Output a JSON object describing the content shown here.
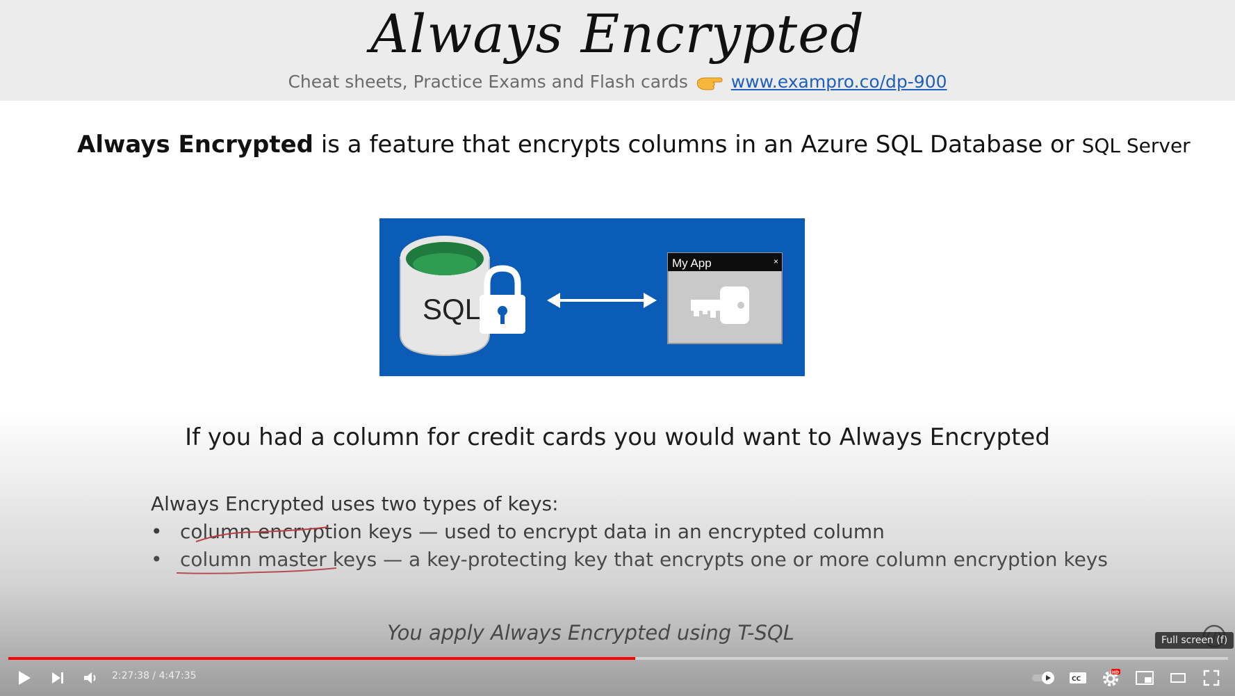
{
  "slide": {
    "title": "Always Encrypted",
    "subtitle_text": "Cheat sheets, Practice Exams and Flash cards",
    "subtitle_link": "www.exampro.co/dp-900",
    "intro_bold": "Always Encrypted",
    "intro_rest": " is a feature that encrypts columns in an Azure SQL Database or ",
    "intro_small": "SQL Server",
    "diagram": {
      "sql_label": "SQL",
      "app_title": "My App",
      "app_close": "×",
      "bg_color": "#0b5cb7"
    },
    "caption": "If you had a column for credit cards you would want to Always Encrypted",
    "keys_heading": "Always Encrypted uses two types of keys:",
    "key_items": [
      "column encryption keys —  used to encrypt data in an encrypted column",
      "column master keys — a key-protecting key that encrypts one or more column encryption keys"
    ],
    "tsql_note": "You apply Always Encrypted using T-SQL"
  },
  "player": {
    "time_display": "2:27:38 / 4:47:35",
    "progress_fraction": 0.514,
    "tooltip": "Full screen (f)",
    "hd_badge": "HD",
    "icons": [
      "play-icon",
      "next-icon",
      "volume-icon",
      "autoplay-toggle-icon",
      "captions-icon",
      "settings-icon",
      "miniplayer-icon",
      "theater-icon",
      "fullscreen-icon"
    ],
    "accent_color": "#ff0000"
  }
}
